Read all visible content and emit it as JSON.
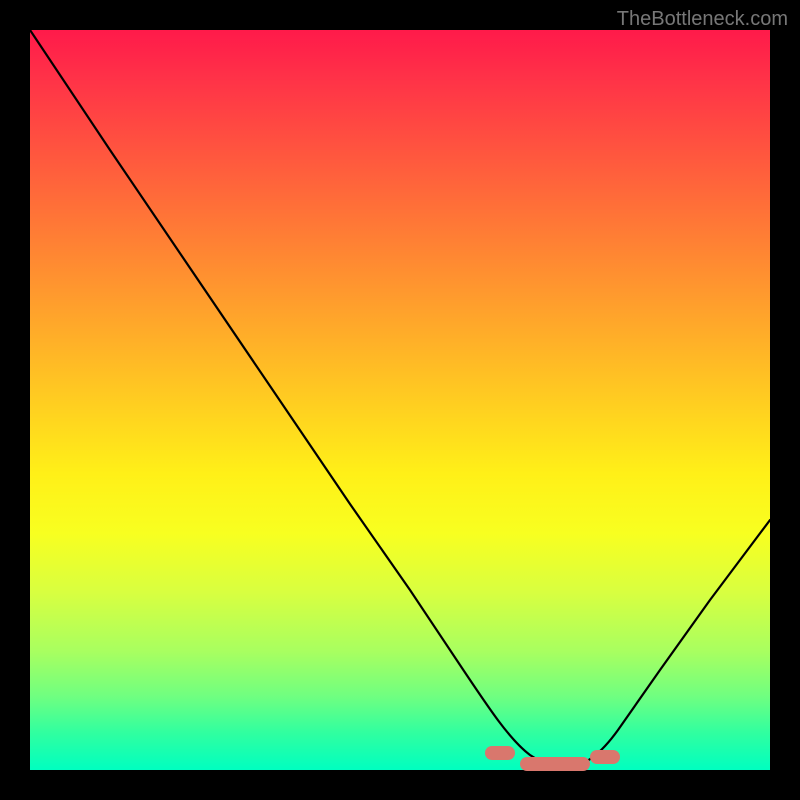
{
  "watermark": "TheBottleneck.com",
  "chart_data": {
    "type": "line",
    "title": "",
    "xlabel": "",
    "ylabel": "",
    "x": [
      0,
      5,
      10,
      15,
      20,
      25,
      30,
      35,
      40,
      45,
      50,
      55,
      60,
      65,
      68,
      70,
      72,
      75,
      80,
      85,
      90,
      95,
      100
    ],
    "values": [
      100,
      92,
      84,
      76,
      68,
      60,
      52,
      44,
      36,
      28,
      20,
      13,
      7,
      3,
      1,
      0,
      1,
      3,
      8,
      14,
      20,
      26,
      32
    ],
    "xlim": [
      0,
      100
    ],
    "ylim": [
      0,
      100
    ],
    "note": "Background is a vertical heat gradient red→yellow→green. Minimum (optimal point) occurs near x≈70. Short pink/red segment markers sit near the valley bottom."
  }
}
